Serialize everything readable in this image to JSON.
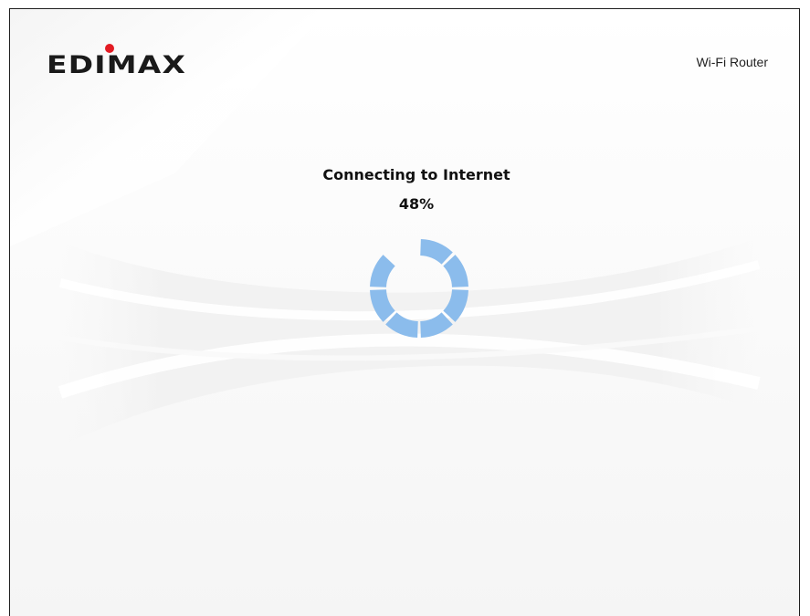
{
  "brand": {
    "logo_text": "EDIMAX",
    "accent_color": "#e31b23"
  },
  "header": {
    "product_name": "Wi-Fi Router"
  },
  "status": {
    "title": "Connecting to Internet",
    "percent_label": "48%",
    "progress": 0.48
  },
  "spinner": {
    "icon": "loading-ring-icon",
    "color": "#8bbcec",
    "segment_count": 8,
    "missing_segment": 7
  }
}
